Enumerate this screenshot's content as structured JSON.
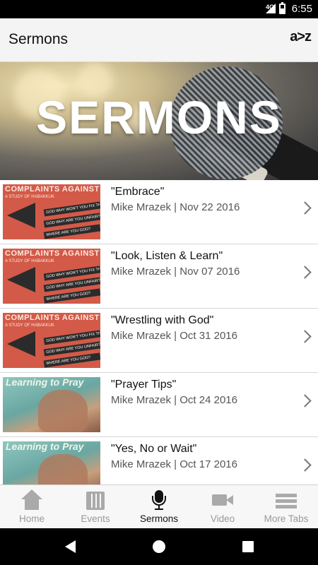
{
  "status_bar": {
    "network": "4G",
    "time": "6:55"
  },
  "header": {
    "title": "Sermons",
    "az_label": "a>z"
  },
  "hero": {
    "title": "SERMONS"
  },
  "sermons": [
    {
      "title": "\"Embrace\"",
      "meta": "Mike Mrazek | Nov 22 2016",
      "art": "Complaints Against God"
    },
    {
      "title": "\"Look, Listen & Learn\"",
      "meta": "Mike Mrazek | Nov 07 2016",
      "art": "Complaints Against God"
    },
    {
      "title": "\"Wrestling with God\"",
      "meta": "Mike Mrazek | Oct 31 2016",
      "art": "Complaints Against God"
    },
    {
      "title": "\"Prayer Tips\"",
      "meta": "Mike Mrazek | Oct 24 2016",
      "art": "Learning to Pray"
    },
    {
      "title": "\"Yes, No or Wait\"",
      "meta": "Mike Mrazek | Oct 17 2016",
      "art": "Learning to Pray"
    }
  ],
  "art": {
    "complaints": {
      "title": "COMPLAINTS AGAINST GOD",
      "subtitle": "A STUDY OF HABAKKUK",
      "lines": [
        "GOD WHY WON'T YOU FIX THIS?",
        "GOD WHY ARE YOU UNFAIR?",
        "WHERE ARE YOU GOD?"
      ]
    },
    "pray": {
      "title": "Learning to Pray"
    }
  },
  "tabs": [
    {
      "label": "Home",
      "icon": "home-icon",
      "active": false
    },
    {
      "label": "Events",
      "icon": "calendar-icon",
      "active": false
    },
    {
      "label": "Sermons",
      "icon": "microphone-icon",
      "active": true
    },
    {
      "label": "Video",
      "icon": "video-camera-icon",
      "active": false
    },
    {
      "label": "More Tabs",
      "icon": "menu-icon",
      "active": false
    }
  ],
  "colors": {
    "accent_active": "#111111",
    "tab_inactive": "#aaaaaa",
    "thumb_red": "#d35a48"
  }
}
